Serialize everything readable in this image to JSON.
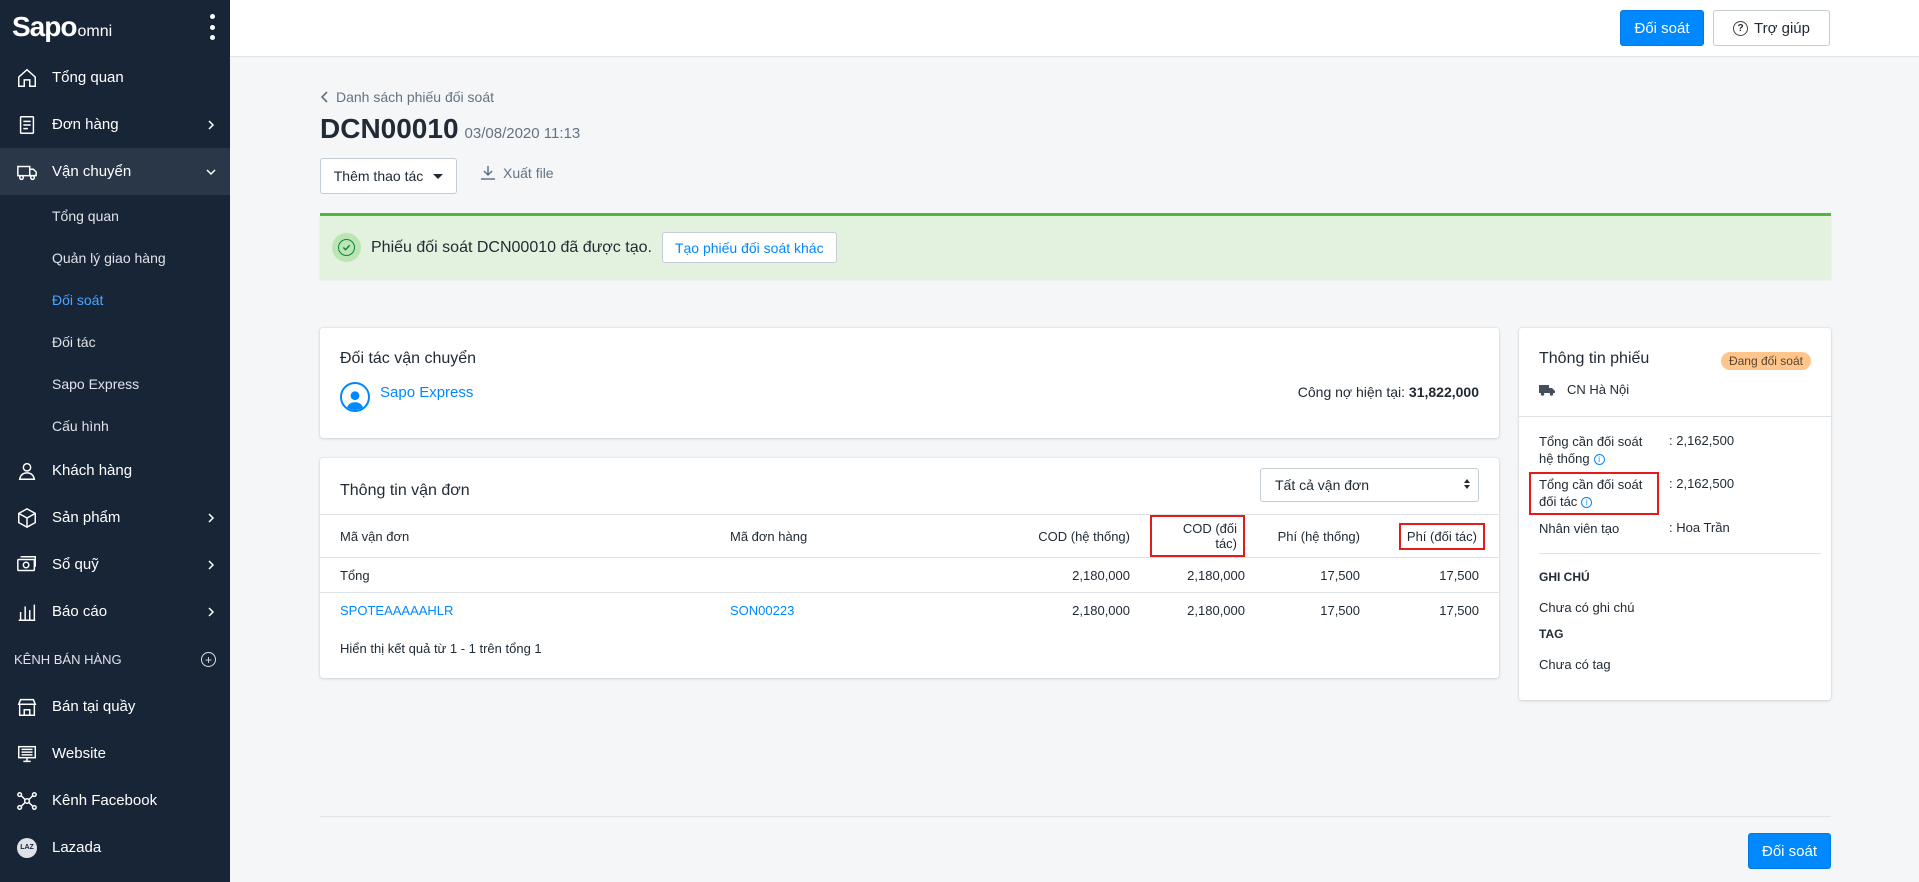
{
  "brand": {
    "logo_main": "Sapo",
    "logo_sub": "omni"
  },
  "sidebar": {
    "items": [
      {
        "label": "Tổng quan",
        "icon": "home-icon"
      },
      {
        "label": "Đơn hàng",
        "icon": "order-icon"
      },
      {
        "label": "Vận chuyển",
        "icon": "truck-icon"
      },
      {
        "label": "Khách hàng",
        "icon": "user-icon"
      },
      {
        "label": "Sản phẩm",
        "icon": "box-icon"
      },
      {
        "label": "Sổ quỹ",
        "icon": "cash-icon"
      },
      {
        "label": "Báo cáo",
        "icon": "chart-icon"
      }
    ],
    "shipping_sub": [
      "Tổng quan",
      "Quản lý giao hàng",
      "Đối soát",
      "Đối tác",
      "Sapo Express",
      "Cấu hình"
    ],
    "sales_channels_label": "KÊNH BÁN HÀNG",
    "channels": [
      {
        "label": "Bán tại quầy",
        "icon": "pos-icon"
      },
      {
        "label": "Website",
        "icon": "website-icon"
      },
      {
        "label": "Kênh Facebook",
        "icon": "facebook-channel-icon"
      },
      {
        "label": "Lazada",
        "icon": "lazada-icon",
        "badge": "LAZ"
      }
    ]
  },
  "topbar": {
    "reconcile_label": "Đối soát",
    "help_label": "Trợ giúp"
  },
  "page": {
    "breadcrumb": "Danh sách phiếu đối soát",
    "code": "DCN00010",
    "datetime": "03/08/2020 11:13",
    "more_actions": "Thêm thao tác",
    "export": "Xuất file"
  },
  "alert": {
    "message": "Phiếu đối soát DCN00010 đã được tạo.",
    "button": "Tạo phiếu đối soát khác"
  },
  "partner": {
    "title": "Đối tác vận chuyển",
    "name": "Sapo Express",
    "debt_label": "Công nợ hiện tại:",
    "debt_value": "31,822,000"
  },
  "orders": {
    "title": "Thông tin vận đơn",
    "filter": "Tất cả vận đơn",
    "columns": [
      "Mã vận đơn",
      "Mã đơn hàng",
      "COD (hệ thống)",
      "COD (đối tác)",
      "Phí (hệ thống)",
      "Phí (đối tác)"
    ],
    "total_row": [
      "Tổng",
      "",
      "2,180,000",
      "2,180,000",
      "17,500",
      "17,500"
    ],
    "rows": [
      [
        "SPOTEAAAAAHLR",
        "SON00223",
        "2,180,000",
        "2,180,000",
        "17,500",
        "17,500"
      ]
    ],
    "footer": "Hiển thị kết quả từ 1 - 1 trên tổng 1"
  },
  "info": {
    "title": "Thông tin phiếu",
    "status": "Đang đối soát",
    "branch": "CN Hà Nội",
    "system_total_label": "Tổng cần đối soát hệ thống",
    "system_total_value": ": 2,162,500",
    "partner_total_label": "Tổng cần đối soát đối tác",
    "partner_total_value": ": 2,162,500",
    "creator_label": "Nhân viên tạo",
    "creator_value": ": Hoa Trần",
    "note_head": "GHI CHÚ",
    "note_text": "Chưa có ghi chú",
    "tag_head": "TAG",
    "tag_text": "Chưa có tag"
  },
  "bottom": {
    "reconcile_label": "Đối soát"
  },
  "colors": {
    "sidebar": "#182537",
    "primary": "#0088ff",
    "success": "#50b83c",
    "highlight": "#e21b1b",
    "badge": "#ffc58b"
  }
}
